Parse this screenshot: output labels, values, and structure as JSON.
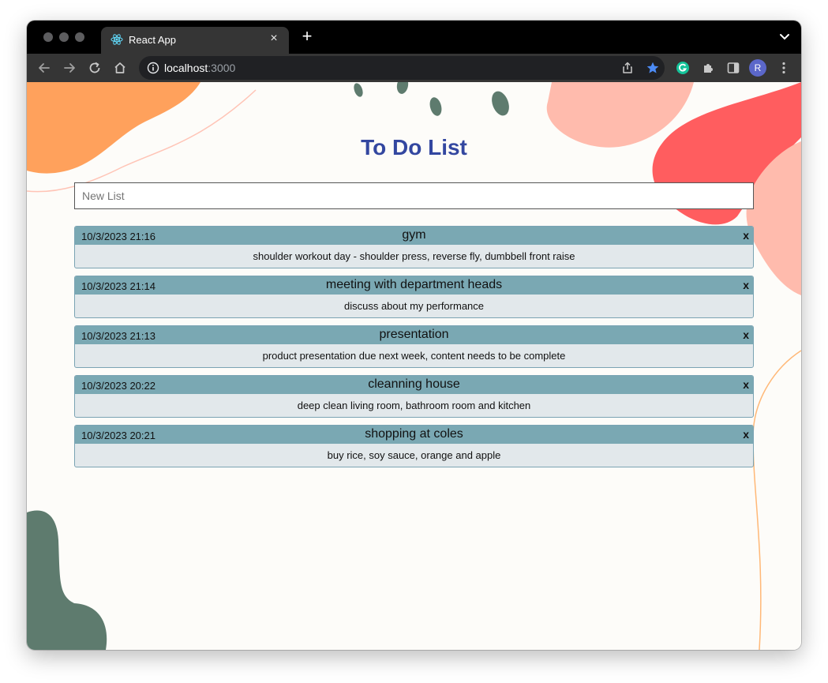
{
  "browser": {
    "tab_title": "React App",
    "tab_close": "×",
    "new_tab": "+",
    "url_host": "localhost",
    "url_port": ":3000",
    "profile_initial": "R",
    "icons": [
      "react-logo-icon",
      "back-icon",
      "forward-icon",
      "reload-icon",
      "home-icon",
      "info-icon",
      "share-icon",
      "bookmark-star-icon",
      "grammarly-icon",
      "extensions-icon",
      "side-panel-icon",
      "menu-dots-icon"
    ]
  },
  "app": {
    "title": "To Do List",
    "new_list_placeholder": "New List",
    "delete_label": "x",
    "colors": {
      "title": "#3347a0",
      "header_bar": "#7aa8b3",
      "body": "#e2e8eb",
      "orange": "#ffa15c",
      "red": "#ff5d5f",
      "pink": "#ffbbad",
      "green": "#5e7b6e"
    },
    "todos": [
      {
        "date": "10/3/2023 21:16",
        "title": "gym",
        "description": "shoulder workout day - shoulder press, reverse fly, dumbbell front raise"
      },
      {
        "date": "10/3/2023 21:14",
        "title": "meeting with department heads",
        "description": "discuss about my performance"
      },
      {
        "date": "10/3/2023 21:13",
        "title": "presentation",
        "description": "product presentation due next week, content needs to be complete"
      },
      {
        "date": "10/3/2023 20:22",
        "title": "cleanning house",
        "description": "deep clean living room, bathroom room and kitchen"
      },
      {
        "date": "10/3/2023 20:21",
        "title": "shopping at coles",
        "description": "buy rice, soy sauce, orange and apple"
      }
    ]
  }
}
